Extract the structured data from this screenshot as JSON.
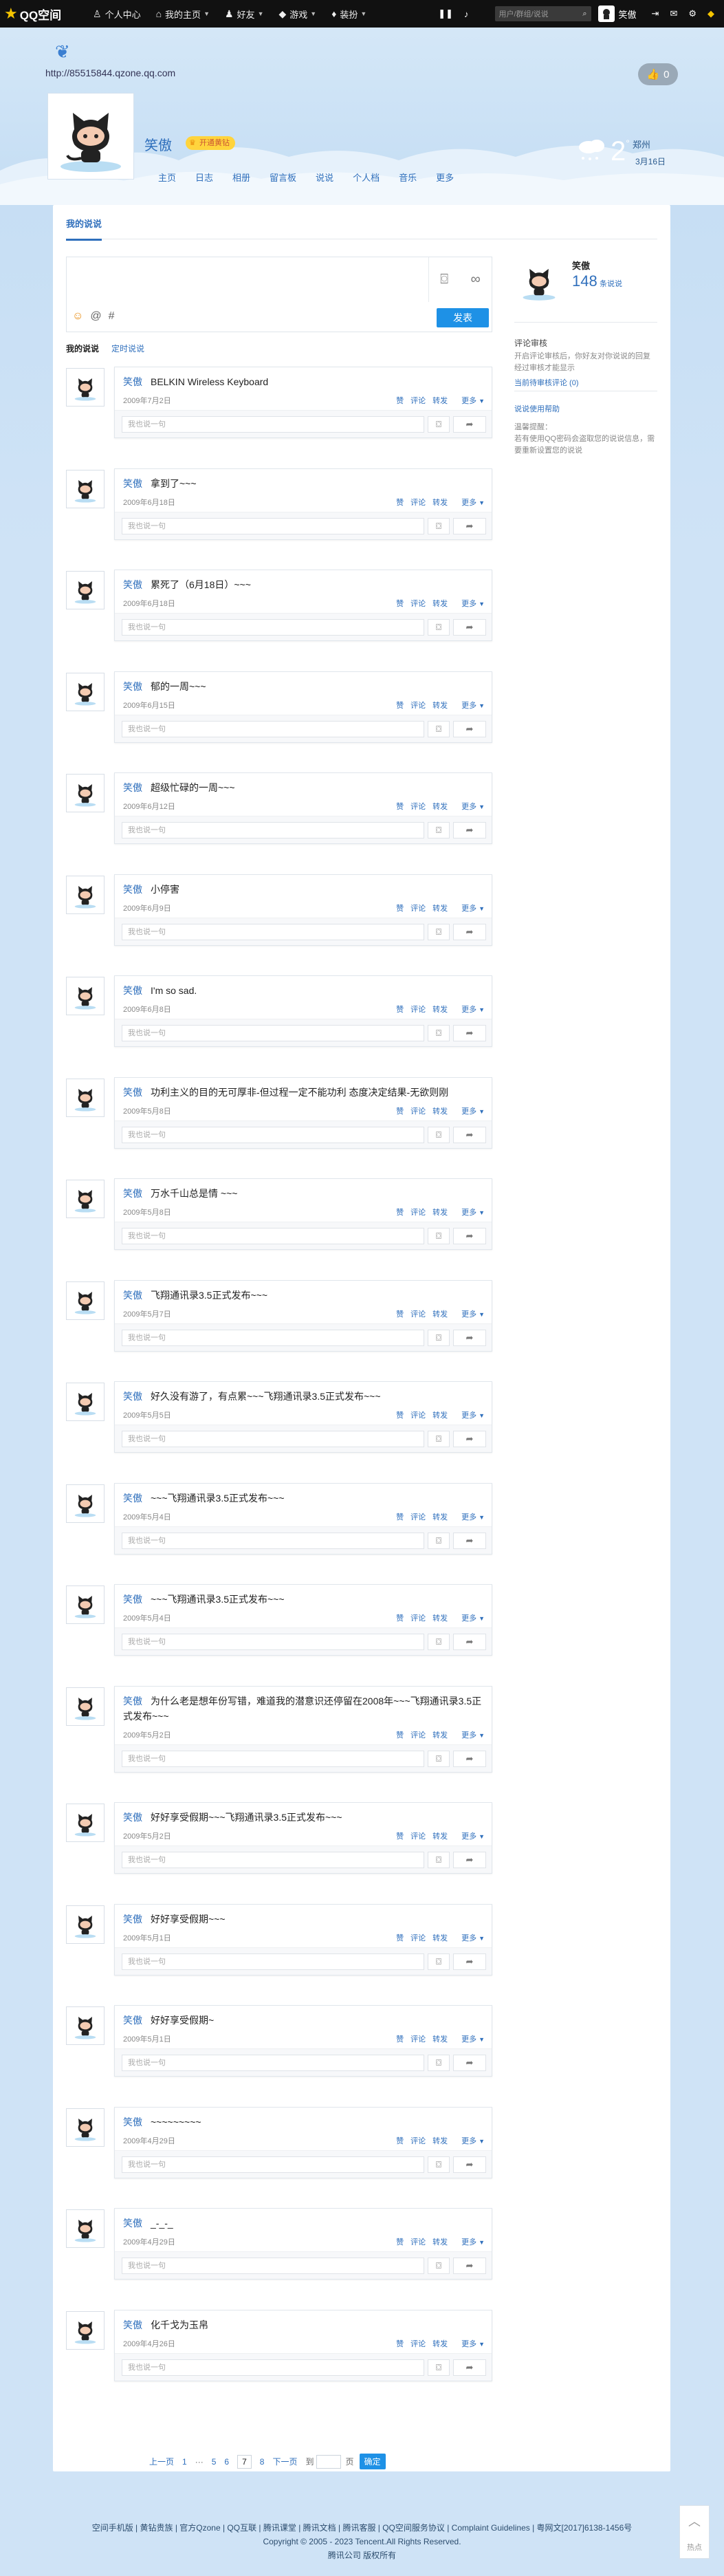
{
  "topbar": {
    "logo": "QQ空间",
    "nav": [
      {
        "icon": "user-icon",
        "glyph": "♙",
        "label": "个人中心",
        "caret": false
      },
      {
        "icon": "home-icon",
        "glyph": "⌂",
        "label": "我的主页",
        "caret": true
      },
      {
        "icon": "friends-icon",
        "glyph": "♟",
        "label": "好友",
        "caret": true
      },
      {
        "icon": "game-icon",
        "glyph": "◆",
        "label": "游戏",
        "caret": true
      },
      {
        "icon": "dressup-icon",
        "glyph": "♦",
        "label": "装扮",
        "caret": true
      }
    ],
    "search_placeholder": "用户/群组/说说",
    "username": "笑傲"
  },
  "header": {
    "url": "http://85515844.qzone.qq.com",
    "like_count": "0",
    "owner_name": "笑傲",
    "vip_label": "开通黄钻",
    "weather": {
      "temp": "2",
      "degree": "°",
      "city": "郑州",
      "date": "3月16日"
    },
    "nav": [
      "主页",
      "日志",
      "相册",
      "留言板",
      "说说",
      "个人档",
      "音乐",
      "更多"
    ]
  },
  "main": {
    "tab": "我的说说",
    "composer": {
      "post_label": "发表"
    },
    "subtabs": [
      "我的说说",
      "定时说说"
    ]
  },
  "posts": [
    {
      "name": "笑傲",
      "text": "BELKIN Wireless Keyboard",
      "time": "2009年7月2日"
    },
    {
      "name": "笑傲",
      "text": "拿到了~~~",
      "time": "2009年6月18日"
    },
    {
      "name": "笑傲",
      "text": "累死了（6月18日）~~~",
      "time": "2009年6月18日"
    },
    {
      "name": "笑傲",
      "text": "郁的一周~~~",
      "time": "2009年6月15日"
    },
    {
      "name": "笑傲",
      "text": "超级忙碌的一周~~~",
      "time": "2009年6月12日"
    },
    {
      "name": "笑傲",
      "text": "小停害",
      "time": "2009年6月9日"
    },
    {
      "name": "笑傲",
      "text": "I'm so sad.",
      "time": "2009年6月8日"
    },
    {
      "name": "笑傲",
      "text": "功利主义的目的无可厚非-但过程一定不能功利 态度决定结果-无欲则刚",
      "time": "2009年5月8日"
    },
    {
      "name": "笑傲",
      "text": "万水千山总是情 ~~~",
      "time": "2009年5月8日"
    },
    {
      "name": "笑傲",
      "text": "飞翔通讯录3.5正式发布~~~",
      "time": "2009年5月7日"
    },
    {
      "name": "笑傲",
      "text": "好久没有游了，有点累~~~飞翔通讯录3.5正式发布~~~",
      "time": "2009年5月5日"
    },
    {
      "name": "笑傲",
      "text": "~~~飞翔通讯录3.5正式发布~~~",
      "time": "2009年5月4日"
    },
    {
      "name": "笑傲",
      "text": "~~~飞翔通讯录3.5正式发布~~~",
      "time": "2009年5月4日"
    },
    {
      "name": "笑傲",
      "text": "为什么老是想年份写错，难道我的潜意识还停留在2008年~~~飞翔通讯录3.5正式发布~~~",
      "time": "2009年5月2日"
    },
    {
      "name": "笑傲",
      "text": "好好享受假期~~~飞翔通讯录3.5正式发布~~~",
      "time": "2009年5月2日"
    },
    {
      "name": "笑傲",
      "text": "好好享受假期~~~",
      "time": "2009年5月1日"
    },
    {
      "name": "笑傲",
      "text": "好好享受假期~",
      "time": "2009年5月1日"
    },
    {
      "name": "笑傲",
      "text": "~~~~~~~~~",
      "time": "2009年4月29日"
    },
    {
      "name": "笑傲",
      "text": "_-_-_",
      "time": "2009年4月29日"
    },
    {
      "name": "笑傲",
      "text": "化千戈为玉帛",
      "time": "2009年4月26日"
    }
  ],
  "post_actions": {
    "like": "赞",
    "comment": "评论",
    "forward": "转发",
    "more": "更多"
  },
  "reply_placeholder": "我也说一句",
  "sidebar": {
    "name": "笑傲",
    "count": "148",
    "count_label": "条说说",
    "audit_title": "评论审核",
    "audit_text": "开启评论审核后，你好友对你说说的回复经过审核才能显示",
    "audit_link": "当前待审核评论 (0)",
    "help_link": "说说使用帮助",
    "tip_title": "温馨提醒：",
    "tip_text": "若有使用QQ密码会盗取您的说说信息，需要重新设置您的说说"
  },
  "pager": {
    "prev": "上一页",
    "p1": "1",
    "ellipsis": "···",
    "p5": "5",
    "p6": "6",
    "p7": "7",
    "p8": "8",
    "next": "下一页",
    "jump": "到",
    "unit": "页",
    "go": "确定"
  },
  "footer": {
    "line1": "空间手机版 | 黄钻贵族 | 官方Qzone | QQ互联 | 腾讯课堂 | 腾讯文档 | 腾讯客服 | QQ空间服务协议 | Complaint Guidelines | 粤网文[2017]6138-1456号",
    "line2": "Copyright © 2005 - 2023 Tencent.All Rights Reserved.",
    "line3": "腾讯公司 版权所有"
  },
  "hotspot_label": "热点"
}
